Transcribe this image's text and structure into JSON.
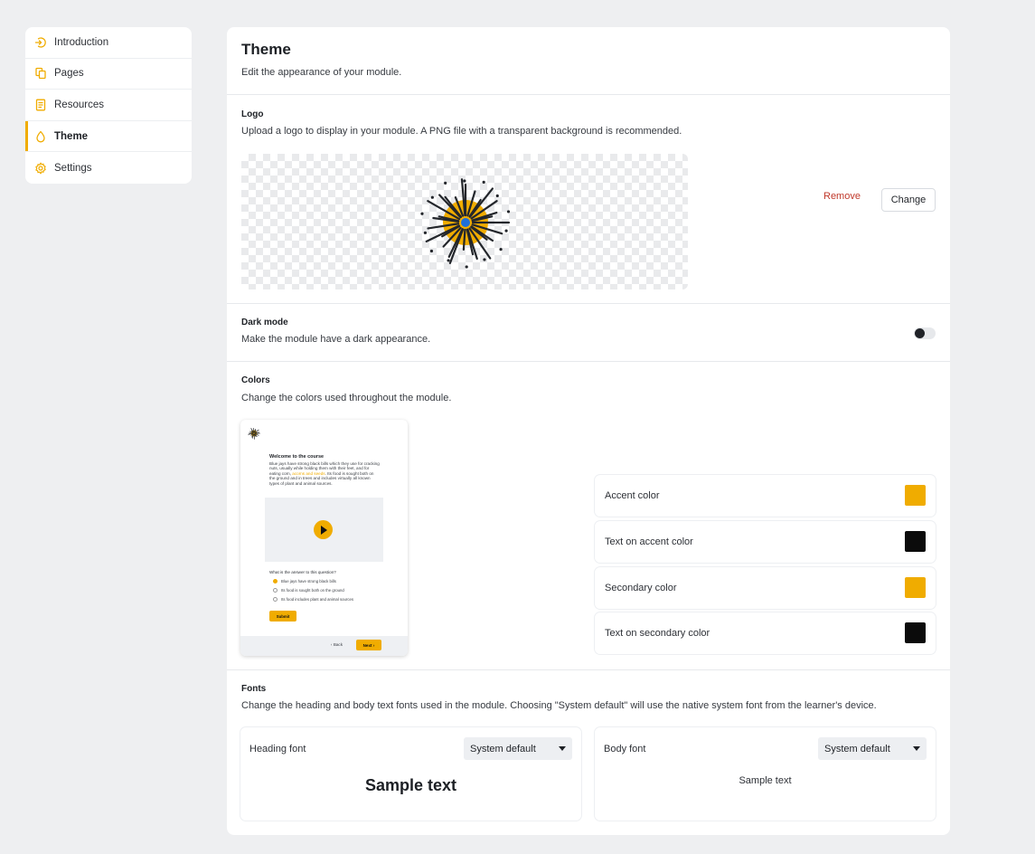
{
  "sidebar": {
    "items": [
      {
        "label": "Introduction",
        "icon": "enter-icon"
      },
      {
        "label": "Pages",
        "icon": "pages-icon"
      },
      {
        "label": "Resources",
        "icon": "document-icon"
      },
      {
        "label": "Theme",
        "icon": "droplet-icon",
        "active": true
      },
      {
        "label": "Settings",
        "icon": "gear-icon"
      }
    ]
  },
  "header": {
    "title": "Theme",
    "subtitle": "Edit the appearance of your module."
  },
  "logo": {
    "heading": "Logo",
    "description": "Upload a logo to display in your module. A PNG file with a transparent background is recommended.",
    "remove_label": "Remove",
    "change_label": "Change"
  },
  "dark_mode": {
    "heading": "Dark mode",
    "description": "Make the module have a dark appearance.",
    "enabled": false
  },
  "colors": {
    "heading": "Colors",
    "description": "Change the colors used throughout the module.",
    "items": [
      {
        "label": "Accent color",
        "value": "#f0ac00"
      },
      {
        "label": "Text on accent color",
        "value": "#0b0b0b"
      },
      {
        "label": "Secondary color",
        "value": "#f0ac00"
      },
      {
        "label": "Text on secondary color",
        "value": "#0b0b0b"
      }
    ]
  },
  "preview": {
    "title": "Welcome to the course",
    "body_before": "Blue jays have strong black bills which they use for cracking nuts, usually while holding them with their feet, and for eating corn, ",
    "body_link": "acorns and seeds",
    "body_after": ". Its food is sought both on the ground and in trees and includes virtually all known types of plant and animal sources.",
    "question": "What is the answer to this question?",
    "options": [
      "Blue jays have strong black bills",
      "Its food is sought both on the ground",
      "Its food includes plant and animal sources"
    ],
    "submit_label": "Submit",
    "back_label": "Back",
    "next_label": "Next"
  },
  "fonts": {
    "heading": "Fonts",
    "description": "Change the heading and body text fonts used in the module. Choosing \"System default\" will use the native system font from the learner's device.",
    "heading_font": {
      "label": "Heading font",
      "value": "System default",
      "sample": "Sample text"
    },
    "body_font": {
      "label": "Body font",
      "value": "System default",
      "sample": "Sample text"
    }
  },
  "accent_color": "#f0ac00"
}
